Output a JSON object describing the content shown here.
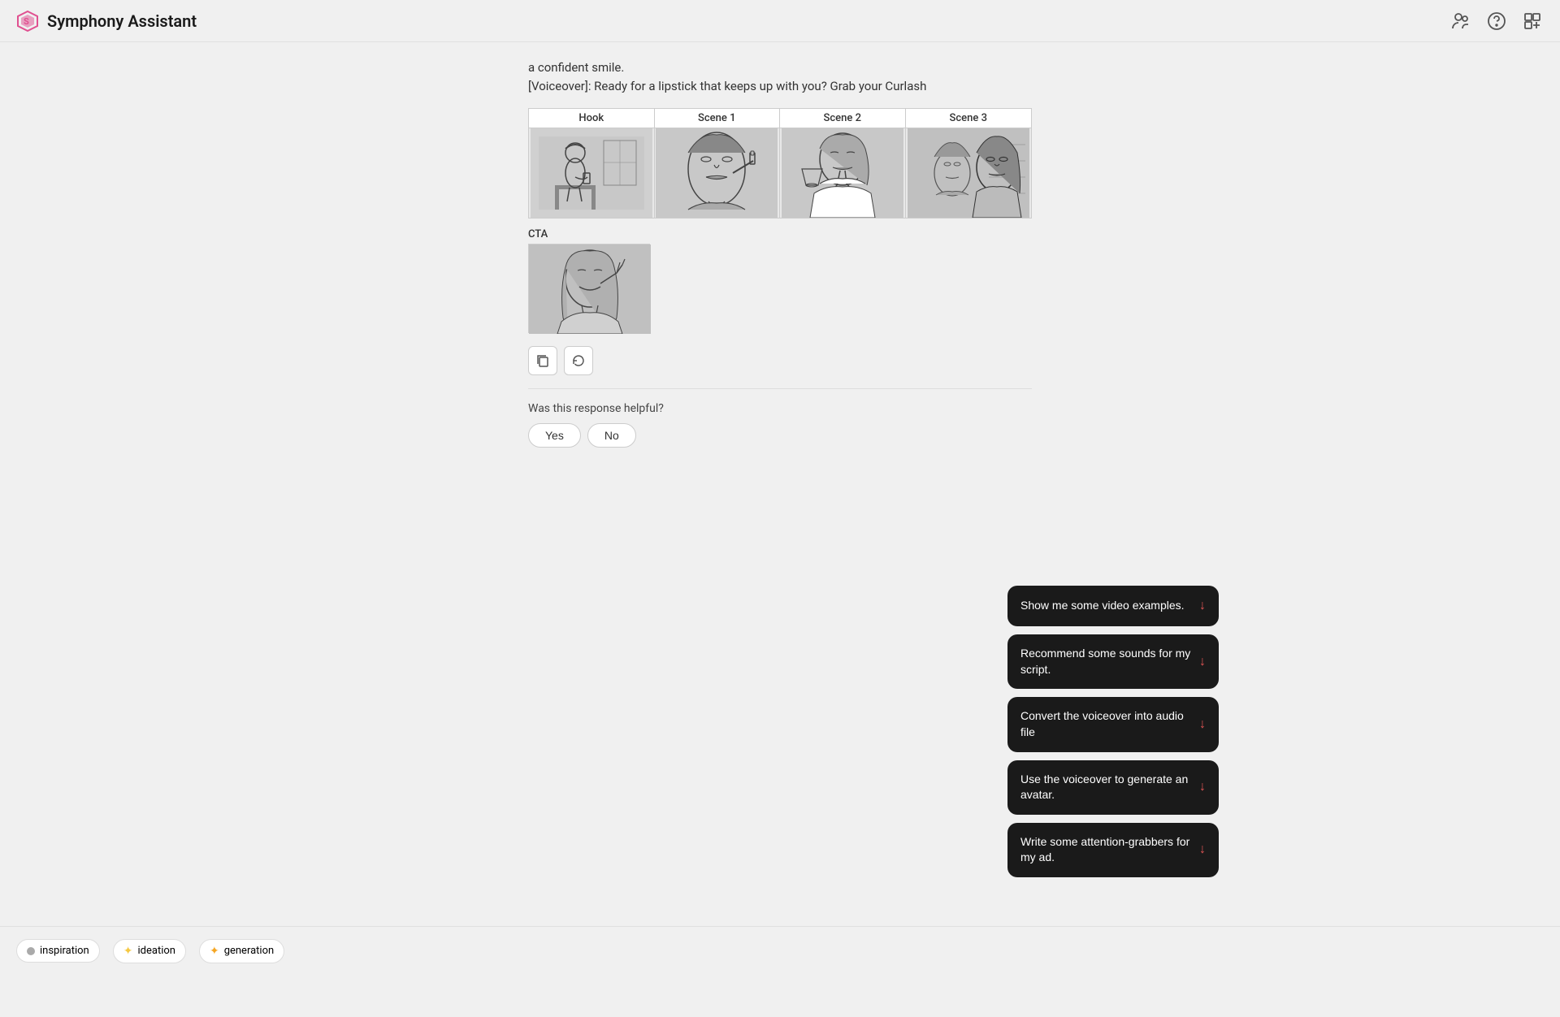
{
  "header": {
    "title": "Symphony Assistant",
    "logo_alt": "Symphony logo"
  },
  "chat": {
    "voiceover_partial": "a confident smile.",
    "voiceover_line": "[Voiceover]: Ready for a lipstick that keeps up with you? Grab your Curlash"
  },
  "storyboard": {
    "columns": [
      {
        "label": "Hook",
        "img_alt": "woman sitting with phone sketch"
      },
      {
        "label": "Scene 1",
        "img_alt": "woman applying lipstick sketch"
      },
      {
        "label": "Scene 2",
        "img_alt": "woman touching lips sketch"
      },
      {
        "label": "Scene 3",
        "img_alt": "two women portrait sketch"
      }
    ],
    "cta": {
      "label": "CTA",
      "img_alt": "woman smiling with phone sketch"
    }
  },
  "action_buttons": [
    {
      "name": "copy-button",
      "icon": "⧉",
      "label": "Copy"
    },
    {
      "name": "refresh-button",
      "icon": "↻",
      "label": "Refresh"
    }
  ],
  "feedback": {
    "question": "Was this response helpful?",
    "yes_label": "Yes",
    "no_label": "No"
  },
  "suggestions": [
    {
      "id": "video-examples",
      "text": "Show me some video examples."
    },
    {
      "id": "sounds",
      "text": "Recommend some sounds for my script."
    },
    {
      "id": "audio-file",
      "text": "Convert the voiceover into audio file"
    },
    {
      "id": "avatar",
      "text": "Use the voiceover to generate an avatar."
    },
    {
      "id": "attention-grabbers",
      "text": "Write some attention-grabbers for my ad."
    }
  ],
  "bottom_tags": [
    {
      "label": "inspiration",
      "color": "#aaaaaa",
      "emoji": "◎"
    },
    {
      "label": "ideation",
      "color": "#f5c842",
      "emoji": "✦"
    },
    {
      "label": "generation",
      "color": "#f5a623",
      "emoji": "✦"
    }
  ]
}
